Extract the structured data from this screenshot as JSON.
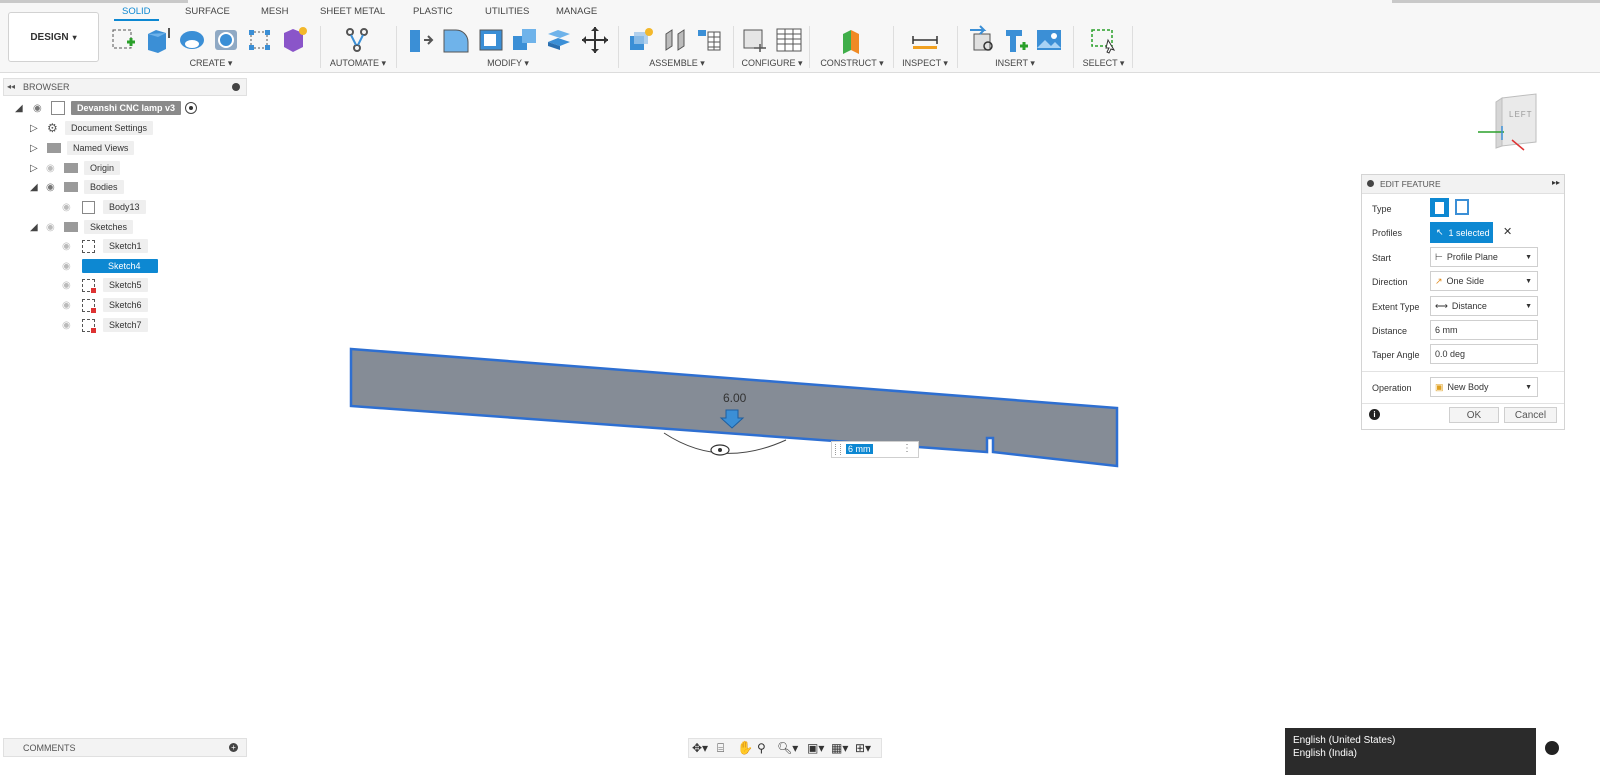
{
  "workspace_button": "DESIGN",
  "tabs": [
    {
      "label": "SOLID",
      "active": true
    },
    {
      "label": "SURFACE",
      "active": false
    },
    {
      "label": "MESH",
      "active": false
    },
    {
      "label": "SHEET METAL",
      "active": false
    },
    {
      "label": "PLASTIC",
      "active": false
    },
    {
      "label": "UTILITIES",
      "active": false
    },
    {
      "label": "MANAGE",
      "active": false
    }
  ],
  "groups": {
    "create": "CREATE ▾",
    "automate": "AUTOMATE ▾",
    "modify": "MODIFY ▾",
    "assemble": "ASSEMBLE ▾",
    "configure": "CONFIGURE ▾",
    "construct": "CONSTRUCT ▾",
    "inspect": "INSPECT ▾",
    "insert": "INSERT ▾",
    "select": "SELECT ▾"
  },
  "browser": {
    "title": "BROWSER",
    "root": "Devanshi CNC lamp v3",
    "items": [
      {
        "label": "Document Settings"
      },
      {
        "label": "Named Views"
      },
      {
        "label": "Origin"
      },
      {
        "label": "Bodies"
      },
      {
        "label": "Body13"
      },
      {
        "label": "Sketches"
      },
      {
        "label": "Sketch1"
      },
      {
        "label": "Sketch4"
      },
      {
        "label": "Sketch5"
      },
      {
        "label": "Sketch6"
      },
      {
        "label": "Sketch7"
      }
    ]
  },
  "comments": {
    "title": "COMMENTS"
  },
  "viewport": {
    "dimension_label": "6.00",
    "input_value": "6 mm",
    "viewcube_face": "LEFT",
    "body_color": "#858c96",
    "edge_color": "#2e6fd1"
  },
  "edit_feature": {
    "title": "EDIT FEATURE",
    "rows": {
      "type": "Type",
      "profiles": "Profiles",
      "profiles_value": "1 selected",
      "start": "Start",
      "start_value": "Profile Plane",
      "direction": "Direction",
      "direction_value": "One Side",
      "extent_type": "Extent Type",
      "extent_value": "Distance",
      "distance": "Distance",
      "distance_value": "6 mm",
      "taper_angle": "Taper Angle",
      "taper_value": "0.0 deg",
      "operation": "Operation",
      "operation_value": "New Body"
    },
    "ok": "OK",
    "cancel": "Cancel"
  },
  "language_popup": {
    "line1": "English (United States)",
    "line2": "English (India)"
  },
  "accent_color": "#0d88d2"
}
